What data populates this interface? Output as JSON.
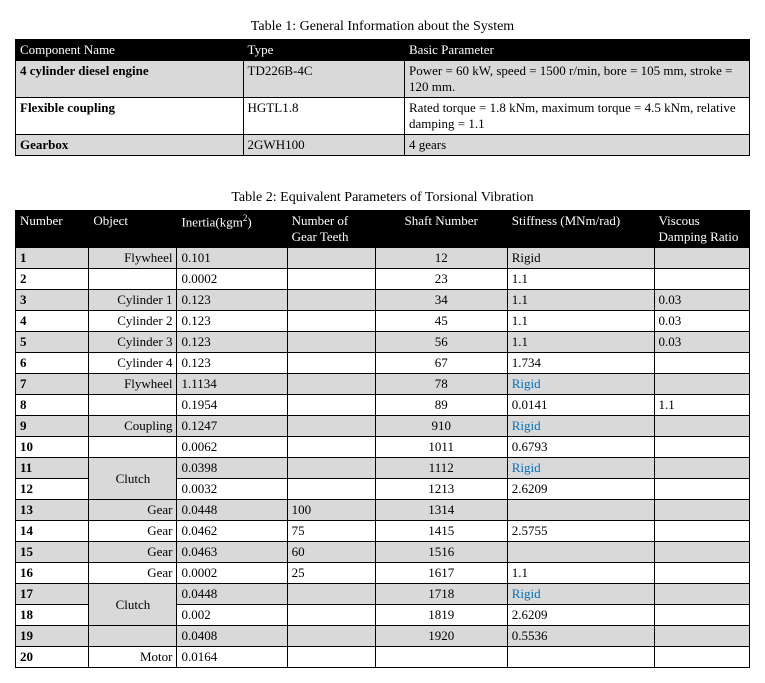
{
  "table1": {
    "caption": "Table 1: General Information about the System",
    "headers": [
      "Component Name",
      "Type",
      "Basic Parameter"
    ],
    "rows": [
      {
        "name": "4 cylinder diesel engine",
        "type": "TD226B-4C",
        "param": "Power = 60 kW, speed = 1500 r/min, bore = 105 mm, stroke = 120 mm."
      },
      {
        "name": "Flexible coupling",
        "type": "HGTL1.8",
        "param": "Rated torque = 1.8 kNm, maximum torque = 4.5 kNm, relative damping = 1.1"
      },
      {
        "name": "Gearbox",
        "type": "2GWH100",
        "param": "4 gears"
      }
    ]
  },
  "table2": {
    "caption": "Table 2: Equivalent Parameters of Torsional Vibration",
    "headers": [
      "Number",
      "Object",
      "Inertia(kgm",
      "Number of Gear Teeth",
      "Shaft Number",
      "Stiffness (MNm/rad)",
      "Viscous Damping Ratio"
    ],
    "rigid": "Rigid",
    "rows": [
      {
        "n": "1",
        "obj": "Flywheel",
        "in": "0.101",
        "teeth": "",
        "shaft": "12",
        "stiff": "Rigid",
        "damp": ""
      },
      {
        "n": "2",
        "obj": "",
        "in": "0.0002",
        "teeth": "",
        "shaft": "23",
        "stiff": "1.1",
        "damp": ""
      },
      {
        "n": "3",
        "obj": "Cylinder 1",
        "in": "0.123",
        "teeth": "",
        "shaft": "34",
        "stiff": "1.1",
        "damp": "0.03"
      },
      {
        "n": "4",
        "obj": "Cylinder 2",
        "in": "0.123",
        "teeth": "",
        "shaft": "45",
        "stiff": "1.1",
        "damp": "0.03"
      },
      {
        "n": "5",
        "obj": "Cylinder 3",
        "in": "0.123",
        "teeth": "",
        "shaft": "56",
        "stiff": "1.1",
        "damp": "0.03"
      },
      {
        "n": "6",
        "obj": "Cylinder 4",
        "in": "0.123",
        "teeth": "",
        "shaft": "67",
        "stiff": "1.734",
        "damp": ""
      },
      {
        "n": "7",
        "obj": "Flywheel",
        "in": "1.1134",
        "teeth": "",
        "shaft": "78",
        "stiff": "Rigid",
        "damp": ""
      },
      {
        "n": "8",
        "obj": "",
        "in": "0.1954",
        "teeth": "",
        "shaft": "89",
        "stiff": "0.0141",
        "damp": "1.1"
      },
      {
        "n": "9",
        "obj": "Coupling",
        "in": "0.1247",
        "teeth": "",
        "shaft": "910",
        "stiff": "Rigid",
        "damp": ""
      },
      {
        "n": "10",
        "obj": "",
        "in": "0.0062",
        "teeth": "",
        "shaft": "1011",
        "stiff": "0.6793",
        "damp": ""
      },
      {
        "n": "11",
        "obj": "Clutch",
        "in": "0.0398",
        "teeth": "",
        "shaft": "1112",
        "stiff": "Rigid",
        "damp": ""
      },
      {
        "n": "12",
        "obj": "",
        "in": "0.0032",
        "teeth": "",
        "shaft": "1213",
        "stiff": "2.6209",
        "damp": ""
      },
      {
        "n": "13",
        "obj": "Gear",
        "in": "0.0448",
        "teeth": "100",
        "shaft": "1314",
        "stiff": "",
        "damp": ""
      },
      {
        "n": "14",
        "obj": "Gear",
        "in": "0.0462",
        "teeth": "75",
        "shaft": "1415",
        "stiff": "2.5755",
        "damp": ""
      },
      {
        "n": "15",
        "obj": "Gear",
        "in": "0.0463",
        "teeth": "60",
        "shaft": "1516",
        "stiff": "",
        "damp": ""
      },
      {
        "n": "16",
        "obj": "Gear",
        "in": "0.0002",
        "teeth": "25",
        "shaft": "1617",
        "stiff": "1.1",
        "damp": ""
      },
      {
        "n": "17",
        "obj": "Clutch",
        "in": "0.0448",
        "teeth": "",
        "shaft": "1718",
        "stiff": "Rigid",
        "damp": ""
      },
      {
        "n": "18",
        "obj": "",
        "in": "0.002",
        "teeth": "",
        "shaft": "1819",
        "stiff": "2.6209",
        "damp": ""
      },
      {
        "n": "19",
        "obj": "",
        "in": "0.0408",
        "teeth": "",
        "shaft": "1920",
        "stiff": "0.5536",
        "damp": ""
      },
      {
        "n": "20",
        "obj": "Motor",
        "in": "0.0164",
        "teeth": "",
        "shaft": "",
        "stiff": "",
        "damp": ""
      }
    ]
  }
}
